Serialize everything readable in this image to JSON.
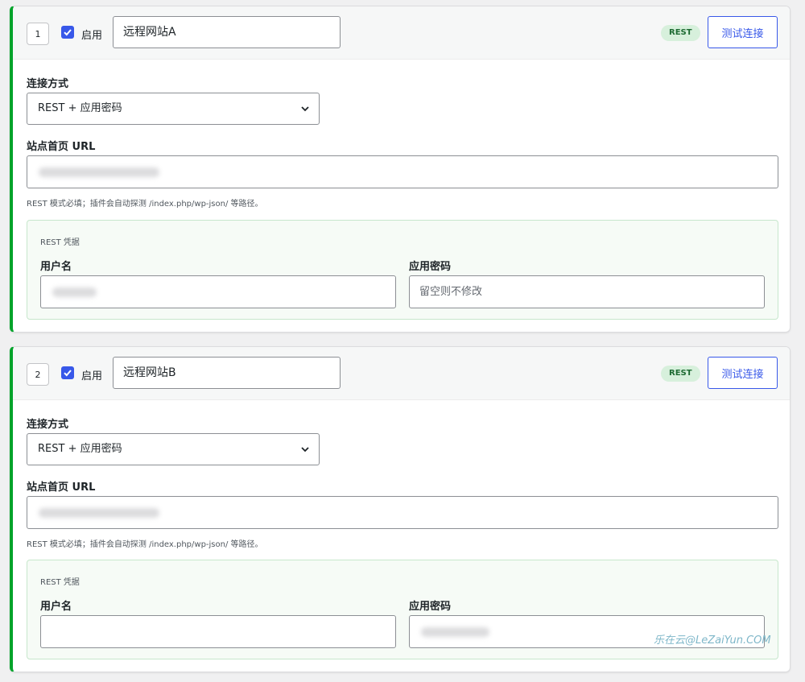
{
  "sites": [
    {
      "index": "1",
      "enabled_label": "启用",
      "name": "远程网站A",
      "badge": "REST",
      "test_button": "测试连接",
      "connection_label": "连接方式",
      "connection_value": "REST + 应用密码",
      "url_label": "站点首页 URL",
      "help": "REST 模式必填；插件会自动探测 /index.php/wp-json/ 等路径。",
      "cred_title": "REST 凭据",
      "username_label": "用户名",
      "password_label": "应用密码",
      "password_placeholder": "留空则不修改"
    },
    {
      "index": "2",
      "enabled_label": "启用",
      "name": "远程网站B",
      "badge": "REST",
      "test_button": "测试连接",
      "connection_label": "连接方式",
      "connection_value": "REST + 应用密码",
      "url_label": "站点首页 URL",
      "help": "REST 模式必填；插件会自动探测 /index.php/wp-json/ 等路径。",
      "cred_title": "REST 凭据",
      "username_label": "用户名",
      "password_label": "应用密码",
      "password_placeholder": ""
    }
  ],
  "watermark": "乐在云@LeZaiYun.COM",
  "colors": {
    "accent": "#3858e9",
    "enabled_border": "#00a32a",
    "badge_bg": "#d7f0dc"
  }
}
